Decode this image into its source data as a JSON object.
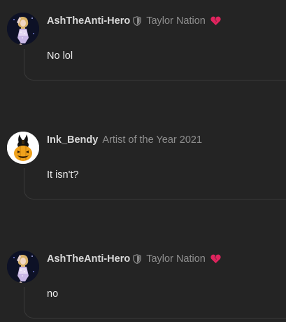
{
  "posts": [
    {
      "username": "AshTheAnti-Hero",
      "title": "Taylor Nation",
      "message": "No lol",
      "avatar_icon": "performer-avatar-icon",
      "badge_icon": "shield-icon",
      "flair_icon": "broken-heart-icon"
    },
    {
      "username": "Ink_Bendy",
      "title": "Artist of the Year 2021",
      "message": "It isn't?",
      "avatar_icon": "pumpkin-avatar-icon"
    },
    {
      "username": "AshTheAnti-Hero",
      "title": "Taylor Nation",
      "message": "no",
      "avatar_icon": "performer-avatar-icon",
      "badge_icon": "shield-icon",
      "flair_icon": "broken-heart-icon"
    }
  ],
  "colors": {
    "background": "#242424",
    "username": "#d9d9d9",
    "title": "#8f8f8f",
    "heart": "#e0245e",
    "pumpkin": "#f0a21c"
  }
}
